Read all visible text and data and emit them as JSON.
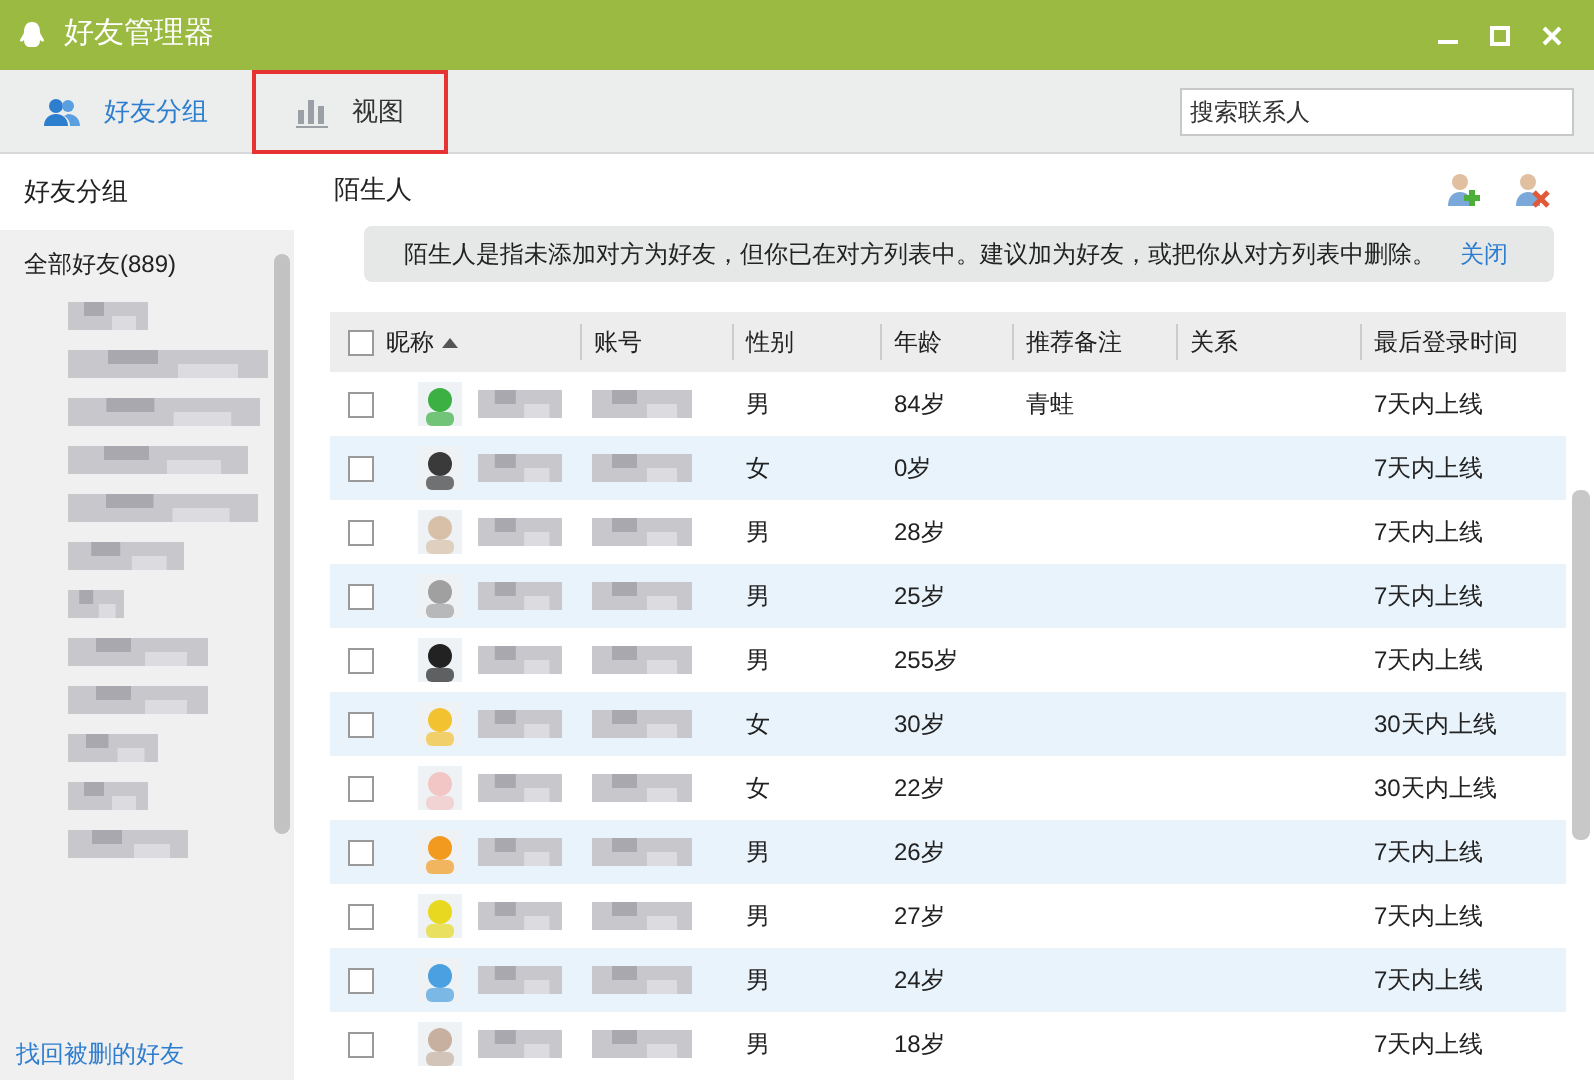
{
  "window": {
    "title": "好友管理器"
  },
  "tabs": [
    {
      "label": "好友分组",
      "selected": true,
      "highlighted": false,
      "kind": "people"
    },
    {
      "label": "视图",
      "selected": false,
      "highlighted": true,
      "kind": "chart"
    }
  ],
  "search": {
    "placeholder": "搜索联系人"
  },
  "sidebar": {
    "title": "好友分组",
    "items": [
      {
        "label": "全部好友(889)"
      }
    ],
    "footer_link": "找回被删的好友"
  },
  "main": {
    "title": "陌生人",
    "notice": "陌生人是指未添加对方为好友，但你已在对方列表中。建议加为好友，或把你从对方列表中删除。",
    "notice_link": "关闭"
  },
  "table": {
    "select_all_checked": false,
    "columns": [
      "昵称",
      "账号",
      "性别",
      "年龄",
      "推荐备注",
      "关系",
      "最后登录时间"
    ],
    "rows": [
      {
        "checked": false,
        "gender": "男",
        "age": "84岁",
        "note": "青蛙",
        "last_login": "7天内上线"
      },
      {
        "checked": false,
        "gender": "女",
        "age": "0岁",
        "last_login": "7天内上线"
      },
      {
        "checked": false,
        "gender": "男",
        "age": "28岁",
        "last_login": "7天内上线"
      },
      {
        "checked": false,
        "gender": "男",
        "age": "25岁",
        "last_login": "7天内上线"
      },
      {
        "checked": false,
        "gender": "男",
        "age": "255岁",
        "last_login": "7天内上线"
      },
      {
        "checked": false,
        "gender": "女",
        "age": "30岁",
        "last_login": "30天内上线"
      },
      {
        "checked": false,
        "gender": "女",
        "age": "22岁",
        "last_login": "30天内上线"
      },
      {
        "checked": false,
        "gender": "男",
        "age": "26岁",
        "last_login": "7天内上线"
      },
      {
        "checked": false,
        "gender": "男",
        "age": "27岁",
        "last_login": "7天内上线"
      },
      {
        "checked": false,
        "gender": "男",
        "age": "24岁",
        "last_login": "7天内上线"
      },
      {
        "checked": false,
        "gender": "男",
        "age": "18岁",
        "last_login": "7天内上线"
      }
    ]
  }
}
